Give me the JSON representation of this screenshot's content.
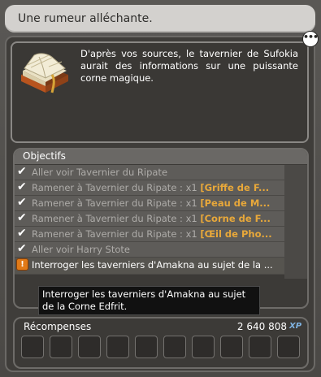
{
  "window": {
    "title": "Une rumeur alléchante."
  },
  "description": "D'après vos sources, le tavernier de Sufokia aurait des informations sur une puissante corne magique.",
  "objectives": {
    "header": "Objectifs",
    "items": [
      {
        "prefix": "Aller voir Tavernier du Ripate",
        "highlight": "",
        "status": "done"
      },
      {
        "prefix": "Ramener à Tavernier du Ripate : x1 ",
        "highlight": "[Griffe de F...",
        "status": "done"
      },
      {
        "prefix": "Ramener à Tavernier du Ripate : x1 ",
        "highlight": "[Peau de M...",
        "status": "done"
      },
      {
        "prefix": "Ramener à Tavernier du Ripate : x1 ",
        "highlight": "[Corne de F...",
        "status": "done"
      },
      {
        "prefix": "Ramener à Tavernier du Ripate : x1 ",
        "highlight": "[Œil de Pho...",
        "status": "done"
      },
      {
        "prefix": "Aller voir Harry Stote",
        "highlight": "",
        "status": "done"
      },
      {
        "prefix": "Interroger les taverniers d'Amakna au sujet de la ...",
        "highlight": "",
        "status": "active"
      }
    ]
  },
  "tooltip": "Interroger les taverniers d'Amakna au sujet de la Corne Edfrit.",
  "rewards": {
    "label": "Récompenses",
    "xp_value": "2 640 808",
    "xp_unit": "XP",
    "slot_count": 10
  },
  "icons": {
    "quest_book": "quest-book-icon",
    "chat": "chat-bubble-icon",
    "check": "checkmark-icon",
    "active": "active-objective-icon"
  },
  "colors": {
    "highlight": "#e8a83a",
    "xp": "#7fb2e0",
    "active_icon": "#e07a18"
  }
}
